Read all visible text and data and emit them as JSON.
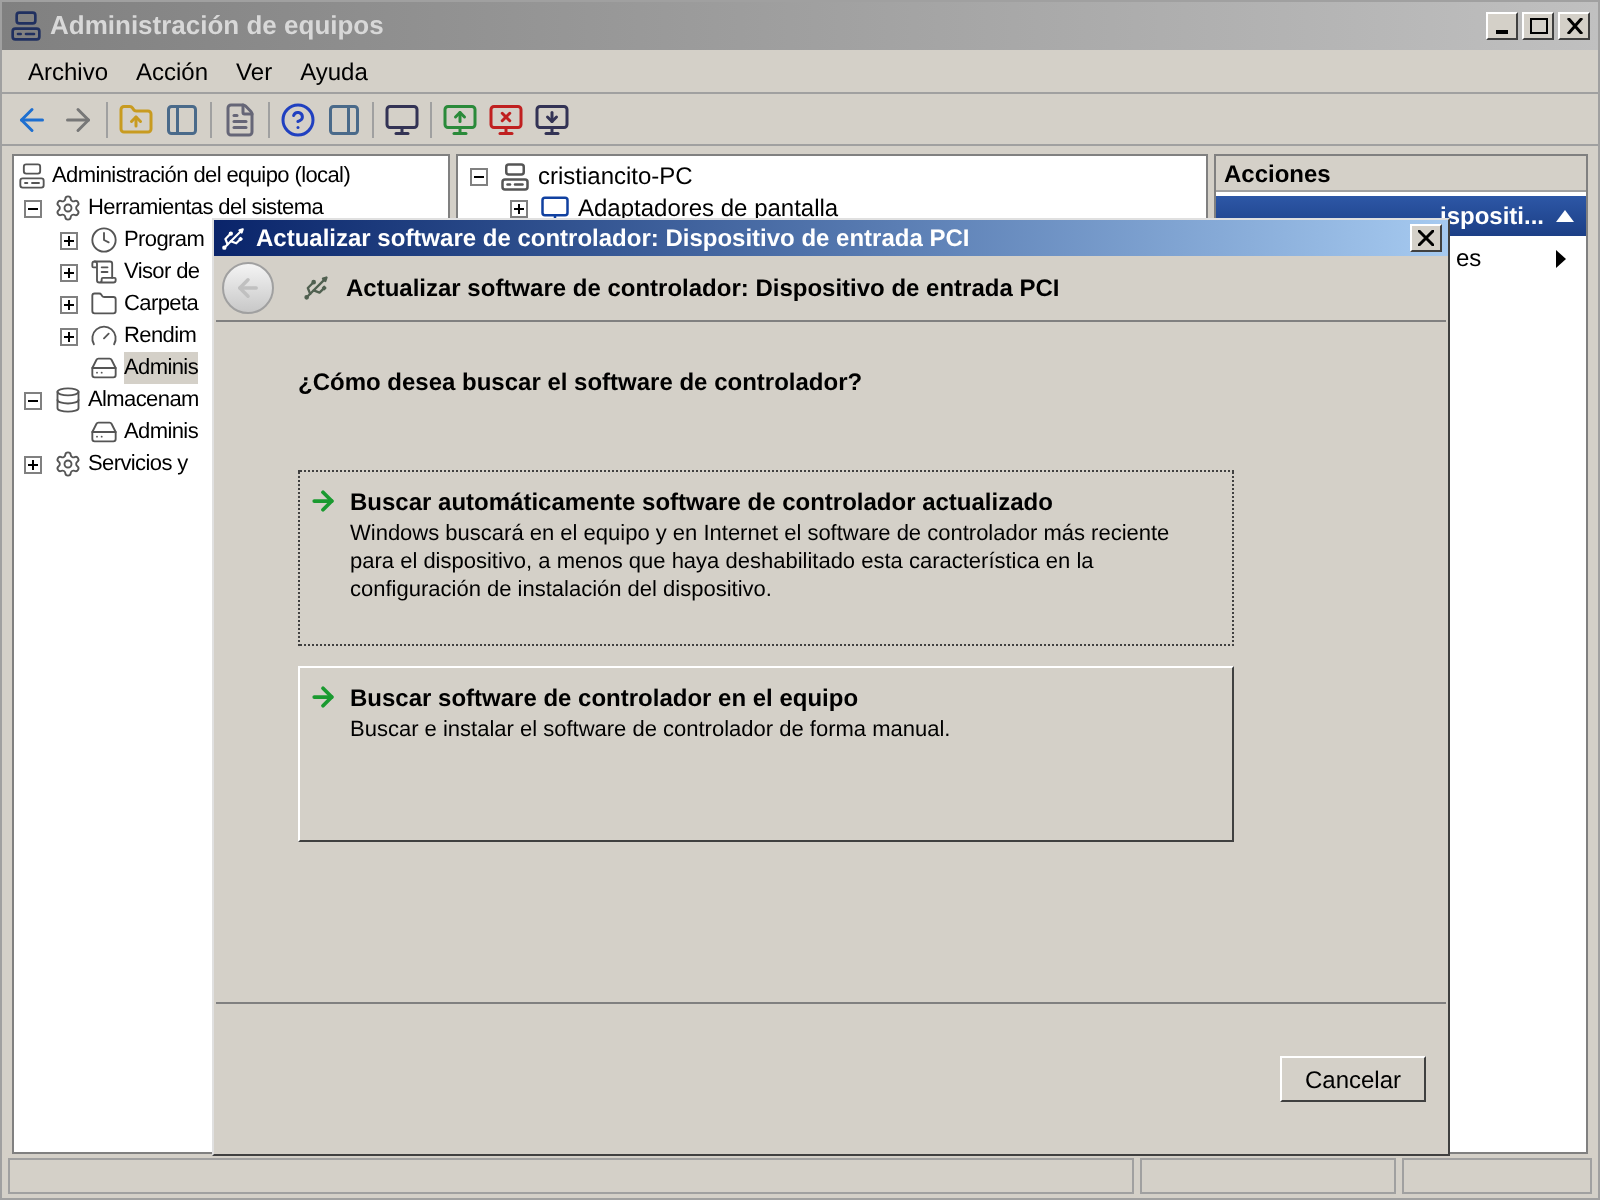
{
  "window": {
    "title": "Administración de equipos"
  },
  "menu": [
    {
      "label": "Archivo"
    },
    {
      "label": "Acción"
    },
    {
      "label": "Ver"
    },
    {
      "label": "Ayuda"
    }
  ],
  "tree": {
    "label": "Administración del equipo (local)",
    "selected": false,
    "children": [
      {
        "label": "Herramientas del sistema",
        "expanded": true,
        "selected": false,
        "children": [
          {
            "label": "Program",
            "expanded": false,
            "selected": false
          },
          {
            "label": "Visor de",
            "expanded": false,
            "selected": false
          },
          {
            "label": "Carpeta",
            "expanded": false,
            "selected": false
          },
          {
            "label": "Rendim",
            "expanded": false,
            "selected": false
          },
          {
            "label": "Adminis",
            "selected": true
          }
        ]
      },
      {
        "label": "Almacenam",
        "expanded": true,
        "selected": false,
        "children": [
          {
            "label": "Adminis",
            "selected": false
          }
        ]
      },
      {
        "label": "Servicios y",
        "expanded": false,
        "selected": false
      }
    ]
  },
  "devices": {
    "label": "cristiancito-PC",
    "expanded": true,
    "children": [
      {
        "label": "Adaptadores de pantalla",
        "expanded": false
      }
    ]
  },
  "actions": {
    "title": "Acciones",
    "section": {
      "label": "ispositi...",
      "expanded": true
    },
    "items": [
      {
        "label": "es"
      }
    ]
  },
  "dialog": {
    "title": "Actualizar software de controlador: Dispositivo de entrada PCI",
    "heading": "Actualizar software de controlador: Dispositivo de entrada PCI",
    "question": "¿Cómo desea buscar el software de controlador?",
    "options": [
      {
        "title": "Buscar automáticamente software de controlador actualizado",
        "description": "Windows buscará en el equipo y en Internet el software de controlador más reciente para el dispositivo, a menos que haya deshabilitado esta característica en la configuración de instalación del dispositivo.",
        "focused": true
      },
      {
        "title": "Buscar software de controlador en el equipo",
        "description": "Buscar e instalar el software de controlador de forma manual.",
        "focused": false
      }
    ],
    "cancel": "Cancelar"
  }
}
